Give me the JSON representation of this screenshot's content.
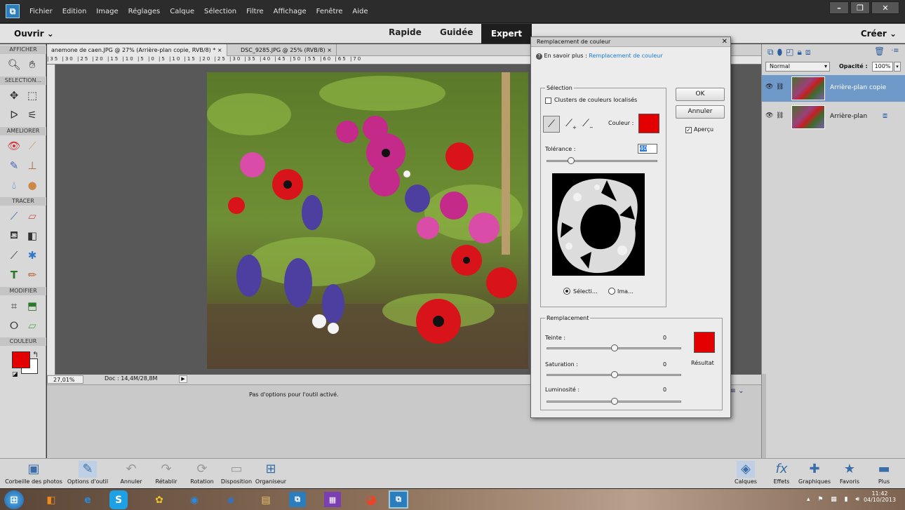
{
  "menubar": {
    "items": [
      "Fichier",
      "Edition",
      "Image",
      "Réglages",
      "Calque",
      "Sélection",
      "Filtre",
      "Affichage",
      "Fenêtre",
      "Aide"
    ]
  },
  "modebar": {
    "open": "Ouvrir",
    "modes": [
      "Rapide",
      "Guidée",
      "Expert"
    ],
    "create": "Créer"
  },
  "toolbox": {
    "sections": [
      "AFFICHER",
      "SELECTION...",
      "AMELIORER",
      "TRACER",
      "MODIFIER",
      "COULEUR"
    ]
  },
  "doctabs": {
    "tab1": "anemone de caen.JPG @ 27% (Arrière-plan copie, RVB/8) *",
    "tab2": "DSC_9285.JPG @ 25% (RVB/8)"
  },
  "ruler_marks": [
    "35",
    "30",
    "25",
    "20",
    "15",
    "10",
    "5",
    "0",
    "5",
    "10",
    "15",
    "20",
    "25",
    "30",
    "35",
    "40",
    "45",
    "50",
    "55",
    "60",
    "65",
    "70"
  ],
  "statusbar": {
    "zoom": "27,01%",
    "doc": "Doc : 14,4M/28,8M"
  },
  "optbar": {
    "message": "Pas d'options pour l'outil activé."
  },
  "layers": {
    "blend_mode": "Normal",
    "opacity_label": "Opacité :",
    "opacity_value": "100%",
    "items": [
      {
        "name": "Arrière-plan copie",
        "selected": true
      },
      {
        "name": "Arrière-plan",
        "selected": false
      }
    ]
  },
  "bottombar": {
    "left": [
      "Corbeille des photos",
      "Options d'outil",
      "Annuler",
      "Rétablir",
      "Rotation",
      "Disposition",
      "Organiseur"
    ],
    "right": [
      "Calques",
      "Effets",
      "Graphiques",
      "Favoris",
      "Plus"
    ]
  },
  "dialog": {
    "title": "Remplacement de couleur",
    "learn_more_prefix": "En savoir plus :",
    "learn_more_link": "Remplacement de couleur",
    "selection_legend": "Sélection",
    "clusters_label": "Clusters de couleurs localisés",
    "color_label": "Couleur :",
    "ok": "OK",
    "cancel": "Annuler",
    "preview": "Aperçu",
    "tolerance_label": "Tolérance :",
    "tolerance_value": "40",
    "tolerance_level": 40,
    "radio_selection": "Sélecti...",
    "radio_image": "Ima...",
    "replacement_legend": "Remplacement",
    "hue_label": "Teinte :",
    "hue_value": "0",
    "saturation_label": "Saturation :",
    "saturation_value": "0",
    "luminosity_label": "Luminosité :",
    "luminosity_value": "0",
    "result_label": "Résultat",
    "swatch_color": "#e20000"
  },
  "taskbar": {
    "time": "11:42",
    "date": "04/10/2013"
  }
}
